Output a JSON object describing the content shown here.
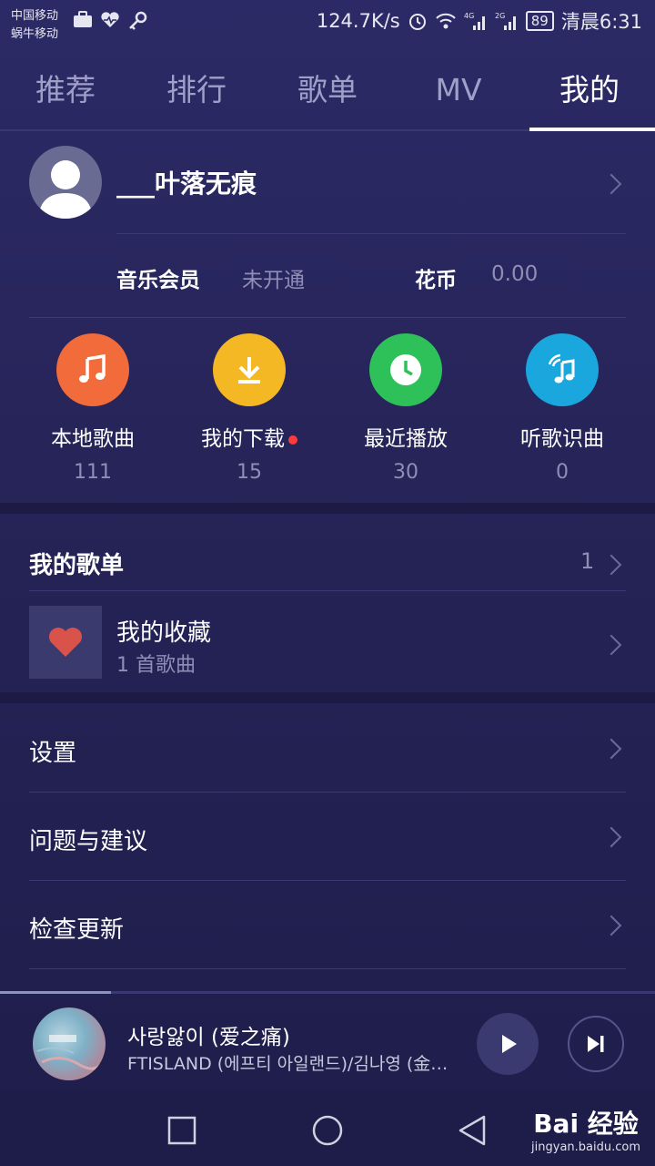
{
  "status_bar": {
    "carrier1": "中国移动",
    "carrier2": "蜗牛移动",
    "speed": "124.7K/s",
    "battery": "89",
    "time": "清晨6:31"
  },
  "tabs": [
    {
      "label": "推荐"
    },
    {
      "label": "排行"
    },
    {
      "label": "歌单"
    },
    {
      "label": "MV"
    },
    {
      "label": "我的"
    }
  ],
  "profile": {
    "username": "___叶落无痕",
    "vip_label": "音乐会员",
    "vip_value": "未开通",
    "coin_label": "花币",
    "coin_value": "0.00"
  },
  "shortcuts": [
    {
      "label": "本地歌曲",
      "count": "111",
      "color": "#f26b3a",
      "icon": "music-note-icon"
    },
    {
      "label": "我的下载",
      "count": "15",
      "color": "#f5b825",
      "icon": "download-icon"
    },
    {
      "label": "最近播放",
      "count": "30",
      "color": "#2ec15a",
      "icon": "clock-icon"
    },
    {
      "label": "听歌识曲",
      "count": "0",
      "color": "#1aa7de",
      "icon": "recognize-music-icon"
    }
  ],
  "playlists": {
    "title": "我的歌单",
    "count": "1",
    "items": [
      {
        "title": "我的收藏",
        "subtitle": "1 首歌曲"
      }
    ]
  },
  "menu": [
    {
      "label": "设置"
    },
    {
      "label": "问题与建议"
    },
    {
      "label": "检查更新"
    }
  ],
  "player": {
    "title": "사랑앓이 (爱之痛)",
    "artist": "FTISLAND (에프티 아일랜드)/김나영 (金…",
    "progress": 0.17
  },
  "watermark": {
    "main": "Bai 经验",
    "sub": "jingyan.baidu.com"
  },
  "colors": {
    "background": "#262458",
    "accent": "#ffffff",
    "muted": "#8e8fb6"
  }
}
